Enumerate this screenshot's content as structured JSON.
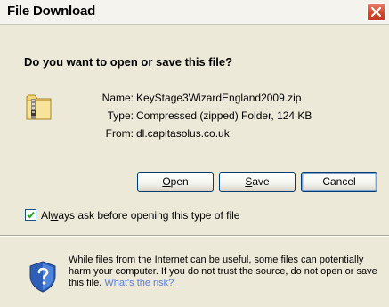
{
  "window": {
    "title": "File Download"
  },
  "dialog": {
    "question": "Do you want to open or save this file?",
    "info": {
      "labels": [
        "Name:",
        "Type:",
        "From:"
      ],
      "values": [
        "KeyStage3WizardEngland2009.zip",
        "Compressed (zipped) Folder, 124 KB",
        "dl.capitasolus.co.uk"
      ]
    },
    "buttons": {
      "open": {
        "underline": "O",
        "rest": "pen"
      },
      "save": {
        "underline": "S",
        "rest": "ave"
      },
      "cancel": "Cancel"
    },
    "checkbox": {
      "before": "Al",
      "underline": "w",
      "after": "ays ask before opening this type of file",
      "checked": true
    },
    "warning": {
      "text": "While files from the Internet can be useful, some files can potentially harm your computer. If you do not trust the source, do not open or save this file.",
      "link": "What's the risk?"
    }
  },
  "icons": {
    "close": "close-icon",
    "file": "zip-folder-icon",
    "shield": "security-shield-icon",
    "check": "checkmark-icon"
  },
  "colors": {
    "close_button": "#d6462b",
    "link": "#5a7edc",
    "checkbox_check": "#21a121"
  }
}
